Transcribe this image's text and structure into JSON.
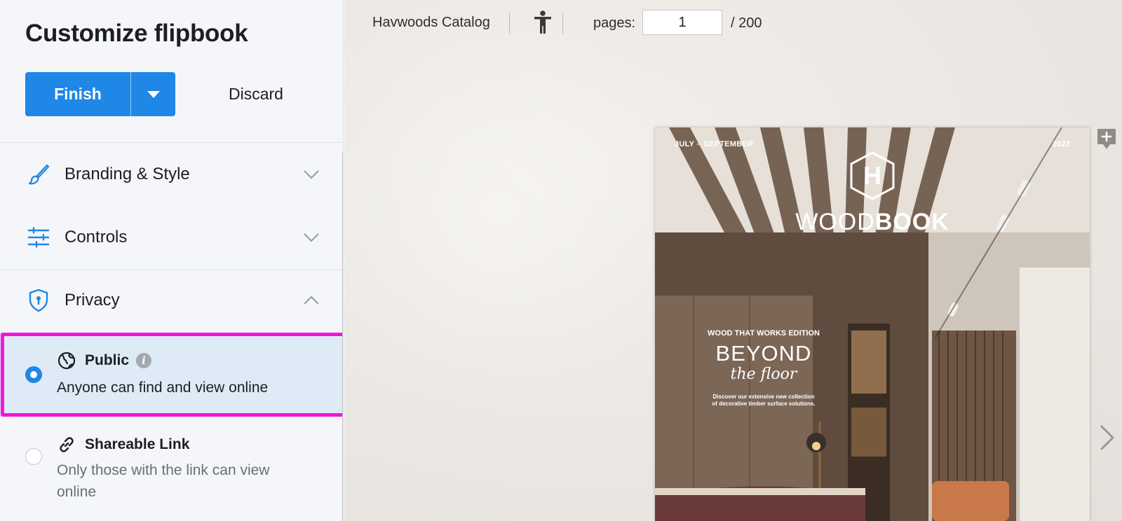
{
  "sidebar": {
    "title": "Customize flipbook",
    "finish_label": "Finish",
    "discard_label": "Discard",
    "sections": [
      {
        "label": "Branding & Style",
        "icon": "paintbrush-icon",
        "expanded": false
      },
      {
        "label": "Controls",
        "icon": "sliders-icon",
        "expanded": false
      },
      {
        "label": "Privacy",
        "icon": "shield-lock-icon",
        "expanded": true
      }
    ],
    "privacy_options": [
      {
        "title": "Public",
        "description": "Anyone can find and view online",
        "icon": "globe-icon",
        "selected": true,
        "has_info": true
      },
      {
        "title": "Shareable Link",
        "description": "Only those with the link can view online",
        "icon": "link-icon",
        "selected": false
      }
    ]
  },
  "toolbar": {
    "document_title": "Havwoods Catalog",
    "pages_label": "pages:",
    "current_page": "1",
    "total_pages": "/  200"
  },
  "cover": {
    "season": "JULY – SEPTEMBER",
    "year": "2023",
    "logo_letter": "H",
    "brand_light": "WOOD",
    "brand_bold": "BOOK",
    "edition": "WOOD THAT WORKS EDITION",
    "headline": "BEYOND",
    "headline_script": "the floor",
    "tagline_line1": "Discover our extensive new collection",
    "tagline_line2": "of decorative timber surface solutions."
  },
  "colors": {
    "accent": "#1f87e5",
    "highlight_frame": "#f215dc",
    "selected_bg": "#deebf7"
  }
}
